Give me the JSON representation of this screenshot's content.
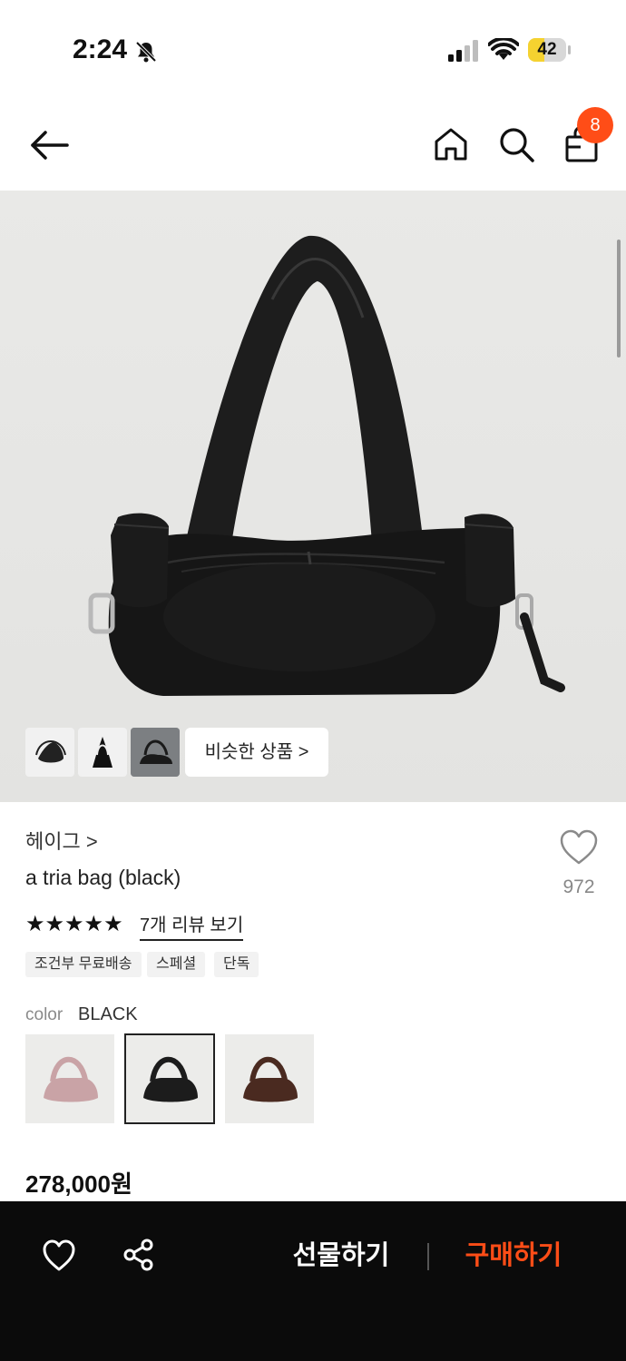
{
  "status_bar": {
    "time": "2:24",
    "battery_level": "42",
    "battery_fraction": 0.42,
    "icons": [
      "bell-slash-icon",
      "cellular-signal-icon",
      "wifi-icon",
      "battery-icon"
    ]
  },
  "header": {
    "icons": [
      "back-arrow-icon",
      "home-icon",
      "search-icon",
      "shopping-bag-icon"
    ],
    "cart_count": "8"
  },
  "gallery": {
    "thumbnails": [
      "thumbnail-1",
      "thumbnail-2",
      "thumbnail-3"
    ],
    "similar_label": "비슷한 상품 >"
  },
  "product": {
    "brand": "헤이그 >",
    "name": "a tria bag (black)",
    "wish_count": "972",
    "rating_stars": 5,
    "stars_text": "★★★★★",
    "review_link": "7개 리뷰 보기",
    "tags": [
      "조건부 무료배송",
      "스페셜",
      "단독"
    ],
    "color_label": "color",
    "color_value": "BLACK",
    "color_options": [
      {
        "name": "pink",
        "hex": "#c9a3a6"
      },
      {
        "name": "black",
        "hex": "#1c1c1c"
      },
      {
        "name": "brown",
        "hex": "#4a2a20"
      }
    ],
    "price": "278,000원"
  },
  "bottom_bar": {
    "gift_label": "선물하기",
    "buy_label": "구매하기",
    "accent": "#ff4d17"
  }
}
